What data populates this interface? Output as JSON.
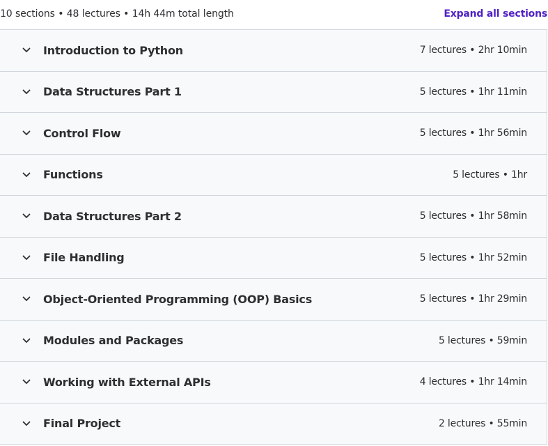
{
  "summary": {
    "text": "10 sections • 48 lectures • 14h 44m total length",
    "expand_label": "Expand all sections"
  },
  "icons": {
    "chevron": "chevron-down-icon"
  },
  "colors": {
    "link": "#5022c3",
    "row_background": "#f7f9fa",
    "border": "#d1d7dc",
    "text": "#2d2f31"
  },
  "sections": [
    {
      "title": "Introduction to Python",
      "meta": "7 lectures • 2hr 10min"
    },
    {
      "title": "Data Structures Part 1",
      "meta": "5 lectures • 1hr 11min"
    },
    {
      "title": "Control Flow",
      "meta": "5 lectures • 1hr 56min"
    },
    {
      "title": "Functions",
      "meta": "5 lectures • 1hr"
    },
    {
      "title": "Data Structures Part 2",
      "meta": "5 lectures • 1hr 58min"
    },
    {
      "title": "File Handling",
      "meta": "5 lectures • 1hr 52min"
    },
    {
      "title": "Object-Oriented Programming (OOP) Basics",
      "meta": "5 lectures • 1hr 29min"
    },
    {
      "title": "Modules and Packages",
      "meta": "5 lectures • 59min"
    },
    {
      "title": "Working with External APIs",
      "meta": "4 lectures • 1hr 14min"
    },
    {
      "title": "Final Project",
      "meta": "2 lectures • 55min"
    }
  ]
}
